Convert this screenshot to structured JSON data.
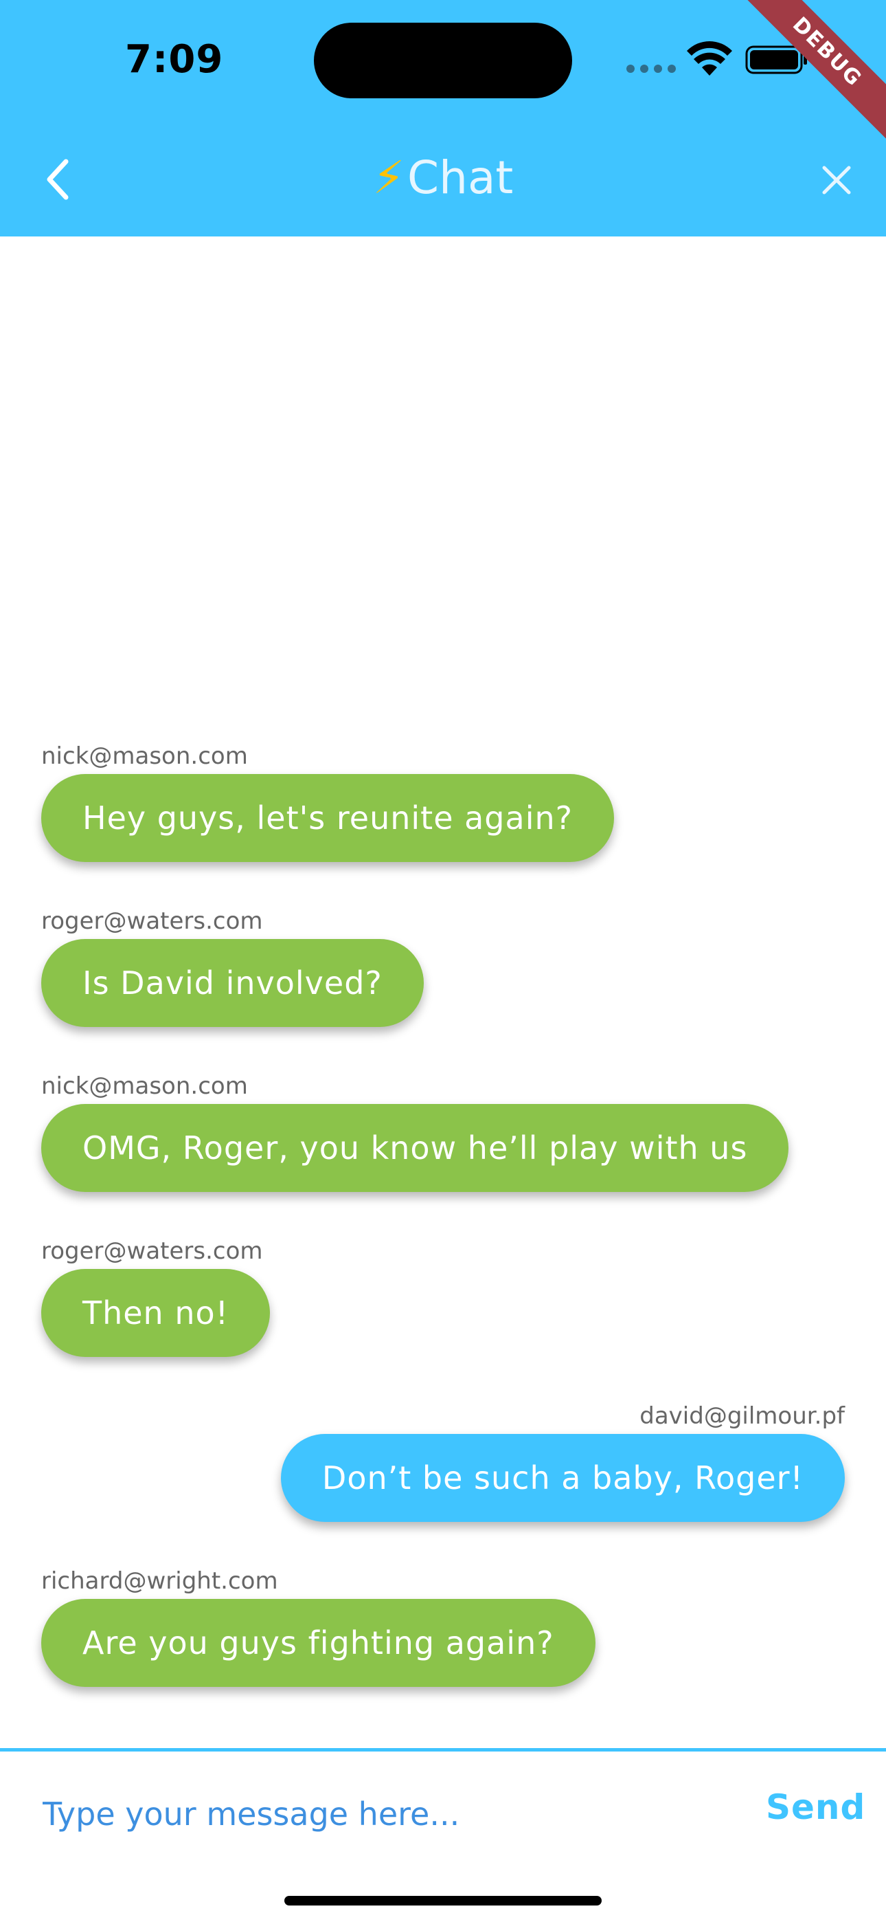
{
  "status_bar": {
    "time": "7:09"
  },
  "debug_banner": "DEBUG",
  "app_bar": {
    "title_icon": "⚡",
    "title": "Chat",
    "back_icon": "chevron-left-icon",
    "close_icon": "close-icon"
  },
  "messages": [
    {
      "sender": "nick@mason.com",
      "text": "Hey guys, let's reunite again?",
      "is_me": false
    },
    {
      "sender": "roger@waters.com",
      "text": "Is David involved?",
      "is_me": false
    },
    {
      "sender": "nick@mason.com",
      "text": "OMG, Roger, you know he’ll play with us",
      "is_me": false
    },
    {
      "sender": "roger@waters.com",
      "text": "Then no!",
      "is_me": false
    },
    {
      "sender": "david@gilmour.pf",
      "text": "Don’t be such a baby, Roger!",
      "is_me": true
    },
    {
      "sender": "richard@wright.com",
      "text": "Are you guys fighting again?",
      "is_me": false
    }
  ],
  "composer": {
    "placeholder": "Type your message here...",
    "value": "",
    "send_label": "Send"
  },
  "colors": {
    "app_bar": "#40c4ff",
    "other_bubble": "#8bc34a",
    "my_bubble": "#40c4ff",
    "send": "#40c4ff",
    "debug_ribbon": "#a13b45"
  }
}
